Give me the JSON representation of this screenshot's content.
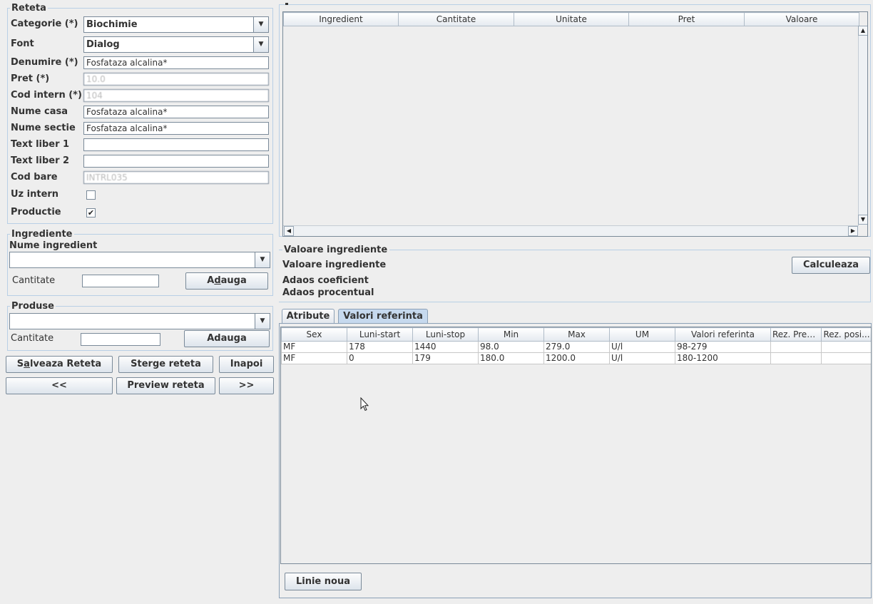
{
  "reteta": {
    "legend": "Reteta",
    "categorie_label": "Categorie (*)",
    "categorie_value": "Biochimie",
    "font_label": "Font",
    "font_value": "Dialog",
    "denumire_label": "Denumire (*)",
    "denumire_value": "Fosfataza alcalina*",
    "pret_label": "Pret (*)",
    "pret_value": "10.0",
    "cod_intern_label": "Cod intern (*)",
    "cod_intern_value": "104",
    "nume_casa_label": "Nume casa",
    "nume_casa_value": "Fosfataza alcalina*",
    "nume_sectie_label": "Nume sectie",
    "nume_sectie_value": "Fosfataza alcalina*",
    "text_liber1_label": "Text liber 1",
    "text_liber1_value": "",
    "text_liber2_label": "Text liber 2",
    "text_liber2_value": "",
    "cod_bare_label": "Cod bare",
    "cod_bare_value": "INTRL035",
    "uz_intern_label": "Uz intern",
    "uz_intern_checked": false,
    "productie_label": "Productie",
    "productie_checked": true,
    "productie_mark": "✔"
  },
  "ingrediente": {
    "legend": "Ingrediente",
    "nume_label": "Nume ingredient",
    "nume_value": "",
    "cantitate_label": "Cantitate",
    "cantitate_value": "",
    "adauga_label": "Adauga"
  },
  "produse": {
    "legend": "Produse",
    "combo_value": "",
    "cantitate_label": "Cantitate",
    "cantitate_value": "",
    "adauga_label": "Adauga"
  },
  "actions": {
    "salveaza_label": "Salveaza Reteta",
    "sterge_label": "Sterge reteta",
    "inapoi_label": "Inapoi",
    "prev_label": "<<",
    "preview_label": "Preview reteta",
    "next_label": ">>"
  },
  "ingredients_table": {
    "columns": [
      "Ingredient",
      "Cantitate",
      "Unitate",
      "Pret",
      "Valoare"
    ],
    "rows": []
  },
  "valoare": {
    "legend": "Valoare ingrediente",
    "valoare_label": "Valoare ingrediente",
    "adaos_coef_label": "Adaos coeficient",
    "adaos_proc_label": "Adaos procentual",
    "calculeaza_label": "Calculeaza"
  },
  "tabs": [
    {
      "label": "Atribute",
      "selected": false
    },
    {
      "label": "Valori referinta",
      "selected": true
    }
  ],
  "ref_table": {
    "columns": [
      "Sex",
      "Luni-start",
      "Luni-stop",
      "Min",
      "Max",
      "UM",
      "Valori referinta",
      "Rez. Prefi...",
      "Rez. posi..."
    ],
    "rows": [
      [
        "MF",
        "178",
        "1440",
        "98.0",
        "279.0",
        "U/l",
        "98-279",
        "",
        ""
      ],
      [
        "MF",
        "0",
        "179",
        "180.0",
        "1200.0",
        "U/l",
        "180-1200",
        "",
        ""
      ]
    ]
  },
  "linie_noua_label": "Linie noua",
  "icons": {
    "dropdown": "chevron-down-icon",
    "scroll_up": "scroll-up-icon",
    "scroll_down": "scroll-down-icon",
    "scroll_left": "scroll-left-icon",
    "scroll_right": "scroll-right-icon",
    "cursor": "mouse-cursor-icon"
  },
  "colors": {
    "background": "#eeeeee",
    "group_border": "#b8cfe5",
    "tab_selected": "#c6d9ee"
  }
}
